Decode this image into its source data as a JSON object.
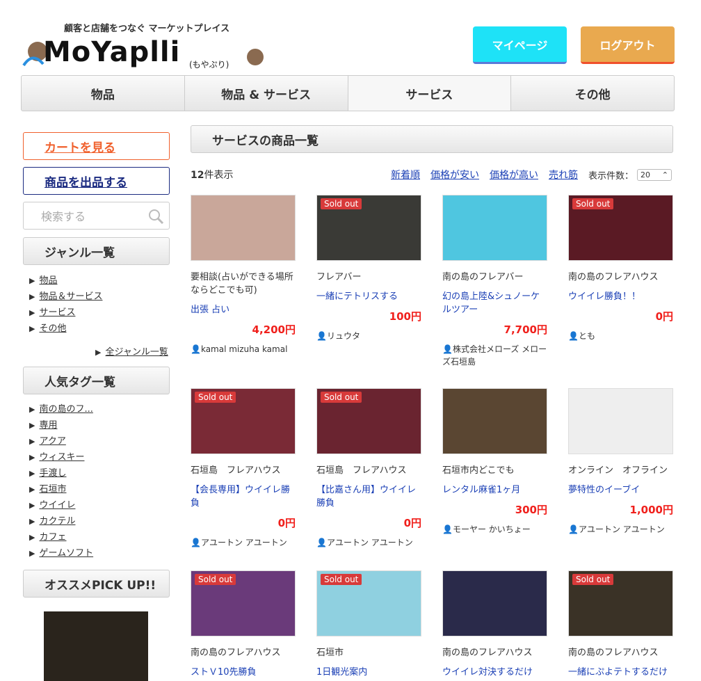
{
  "header": {
    "tagline": "顧客と店舗をつなぐ マーケットプレイス",
    "logo_text": "MoYaplli",
    "logo_sub": "(もやぷり)",
    "mypage": "マイページ",
    "logout": "ログアウト"
  },
  "nav": [
    {
      "label": "物品"
    },
    {
      "label": "物品 & サービス"
    },
    {
      "label": "サービス",
      "active": true
    },
    {
      "label": "その他"
    }
  ],
  "sidebar": {
    "cart": "カートを見る",
    "sell": "商品を出品する",
    "search_placeholder": "検索する",
    "genre_title": "ジャンル一覧",
    "genres": [
      "物品",
      "物品＆サービス",
      "サービス",
      "その他"
    ],
    "all_genres": "全ジャンル一覧",
    "tag_title": "人気タグ一覧",
    "tags": [
      "南の島のフ...",
      "専用",
      "アクア",
      "ウィスキー",
      "手渡し",
      "石垣市",
      "ウイイレ",
      "カクテル",
      "カフェ",
      "ゲームソフト"
    ],
    "pickup_title": "オススメPICK UP!!"
  },
  "main": {
    "title": "サービスの商品一覧",
    "count": "12",
    "count_suffix": "件表示",
    "sorts": [
      "新着順",
      "価格が安い",
      "価格が高い",
      "売れ筋"
    ],
    "per_page_label": "表示件数：",
    "per_page": "20",
    "sold_label": "Sold out",
    "products": [
      {
        "loc": "要相談(占いができる場所ならどこでも可)",
        "title": "出張 占い",
        "price": "4,200円",
        "seller": "kamal mizuha kamal",
        "sold": false,
        "color": "#c9a79a"
      },
      {
        "loc": "フレアバー",
        "title": "一緒にテトリスする",
        "price": "100円",
        "seller": "リュウタ",
        "sold": true,
        "color": "#3a3a36"
      },
      {
        "loc": "南の島のフレアバー",
        "title": "幻の島上陸&シュノーケルツアー",
        "price": "7,700円",
        "seller": "株式会社メローズ メローズ石垣島",
        "sold": false,
        "color": "#4fc6e0"
      },
      {
        "loc": "南の島のフレアハウス",
        "title": "ウイイレ勝負！！",
        "price": "0円",
        "seller": "とも",
        "sold": true,
        "color": "#5a1a24"
      },
      {
        "loc": "石垣島　フレアハウス",
        "title": "【会長専用】ウイイレ勝負",
        "price": "0円",
        "seller": "アユートン アユートン",
        "sold": true,
        "color": "#7a2a36"
      },
      {
        "loc": "石垣島　フレアハウス",
        "title": "【比嘉さん用】ウイイレ勝負",
        "price": "0円",
        "seller": "アユートン アユートン",
        "sold": true,
        "color": "#6a2430"
      },
      {
        "loc": "石垣市内どこでも",
        "title": "レンタル麻雀1ヶ月",
        "price": "300円",
        "seller": "モーヤー かいちょー",
        "sold": false,
        "color": "#5a4632"
      },
      {
        "loc": "オンライン　オフライン",
        "title": "夢特性のイーブイ",
        "price": "1,000円",
        "seller": "アユートン アユートン",
        "sold": false,
        "color": "#eeeeee"
      },
      {
        "loc": "南の島のフレアハウス",
        "title": "ストＶ10先勝負",
        "price": "",
        "seller": "",
        "sold": true,
        "color": "#6a3a7a"
      },
      {
        "loc": "石垣市",
        "title": "1日観光案内",
        "price": "",
        "seller": "",
        "sold": true,
        "color": "#8fd0e0"
      },
      {
        "loc": "南の島のフレアハウス",
        "title": "ウイイレ対決するだけ",
        "price": "",
        "seller": "",
        "sold": false,
        "color": "#2a2a4a"
      },
      {
        "loc": "南の島のフレアハウス",
        "title": "一緒にぷよテトするだけ",
        "price": "",
        "seller": "",
        "sold": true,
        "color": "#3a3226"
      }
    ]
  }
}
